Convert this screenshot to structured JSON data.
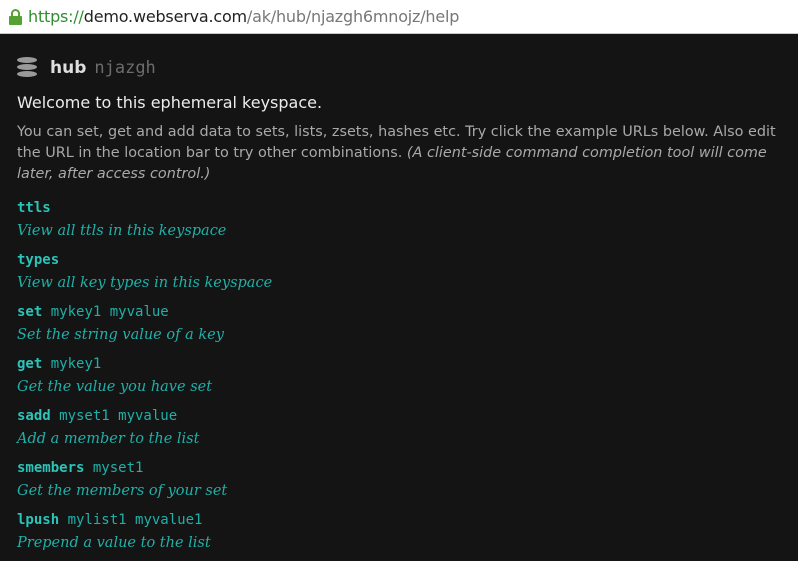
{
  "browser": {
    "url_scheme": "https://",
    "url_host": "demo.webserva.com",
    "url_path": "/ak/hub/njazgh6mnojz/help"
  },
  "hub": {
    "name": "hub",
    "id": "njazgh"
  },
  "welcome": "Welcome to this ephemeral keyspace.",
  "intro": {
    "text": "You can set, get and add data to sets, lists, zsets, hashes etc. Try click the example URLs below. Also edit the URL in the location bar to try other combinations. ",
    "note": "(A client-side command completion tool will come later, after access control.)"
  },
  "commands": [
    {
      "cmd": "ttls",
      "args": "",
      "desc": "View all ttls in this keyspace"
    },
    {
      "cmd": "types",
      "args": "",
      "desc": "View all key types in this keyspace"
    },
    {
      "cmd": "set",
      "args": " mykey1 myvalue",
      "desc": "Set the string value of a key"
    },
    {
      "cmd": "get",
      "args": " mykey1",
      "desc": "Get the value you have set"
    },
    {
      "cmd": "sadd",
      "args": " myset1 myvalue",
      "desc": "Add a member to the list"
    },
    {
      "cmd": "smembers",
      "args": " myset1",
      "desc": "Get the members of your set"
    },
    {
      "cmd": "lpush",
      "args": " mylist1 myvalue1",
      "desc": "Prepend a value to the list"
    }
  ],
  "colors": {
    "accent": "#1fb0a8",
    "background": "#141414",
    "secure": "#57a033"
  }
}
